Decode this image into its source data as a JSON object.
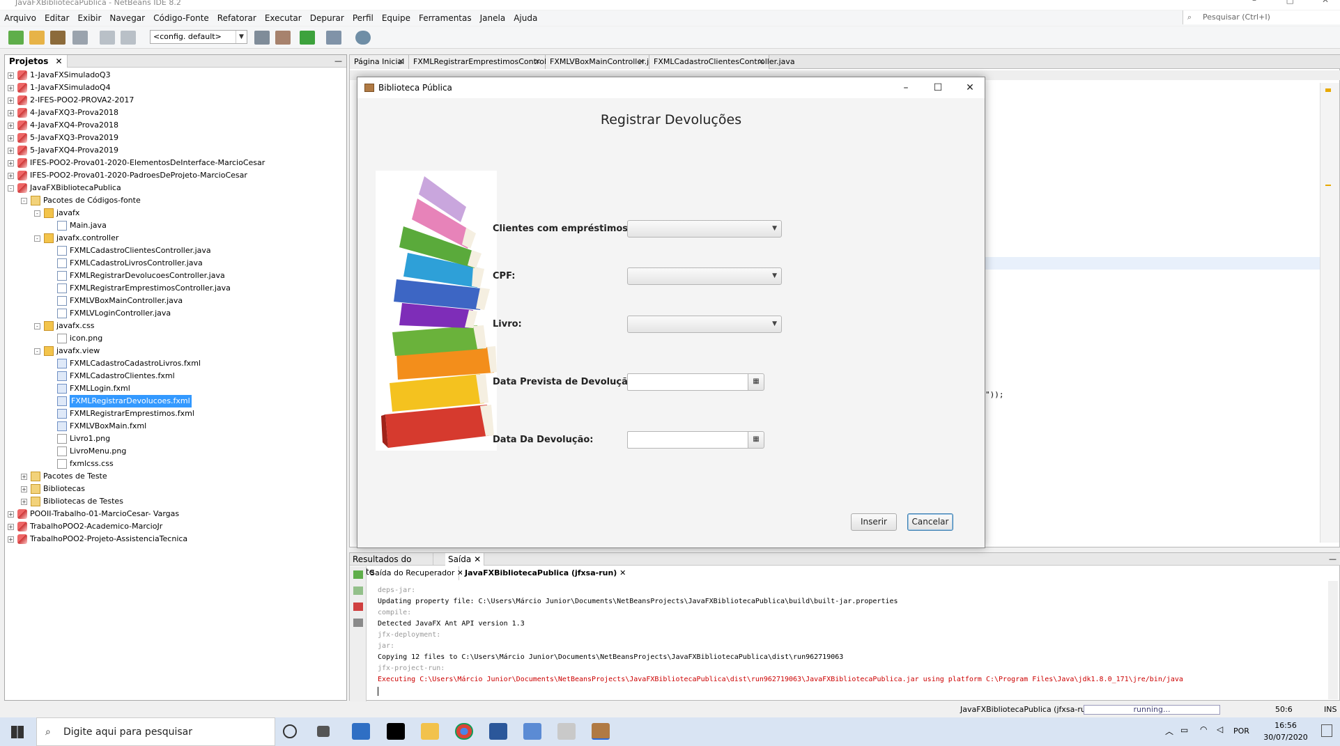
{
  "window": {
    "title": "JavaFXBibliotecaPublica - NetBeans IDE 8.2"
  },
  "menu": [
    "Arquivo",
    "Editar",
    "Exibir",
    "Navegar",
    "Código-Fonte",
    "Refatorar",
    "Executar",
    "Depurar",
    "Perfil",
    "Equipe",
    "Ferramentas",
    "Janela",
    "Ajuda"
  ],
  "search": {
    "placeholder": "Pesquisar (Ctrl+I)"
  },
  "toolbar": {
    "config": "<config. default>"
  },
  "projects": {
    "tab_label": "Projetos",
    "items": [
      {
        "label": "1-JavaFXSimuladoQ3",
        "level": 0,
        "icon": "project-icon",
        "toggle": "+"
      },
      {
        "label": "1-JavaFXSimuladoQ4",
        "level": 0,
        "icon": "project-icon",
        "toggle": "+"
      },
      {
        "label": "2-IFES-POO2-PROVA2-2017",
        "level": 0,
        "icon": "project-icon",
        "toggle": "+"
      },
      {
        "label": "4-JavaFXQ3-Prova2018",
        "level": 0,
        "icon": "project-icon",
        "toggle": "+"
      },
      {
        "label": "4-JavaFXQ4-Prova2018",
        "level": 0,
        "icon": "project-icon",
        "toggle": "+"
      },
      {
        "label": "5-JavaFXQ3-Prova2019",
        "level": 0,
        "icon": "project-icon",
        "toggle": "+"
      },
      {
        "label": "5-JavaFXQ4-Prova2019",
        "level": 0,
        "icon": "project-icon",
        "toggle": "+"
      },
      {
        "label": "IFES-POO2-Prova01-2020-ElementosDeInterface-MarcioCesar",
        "level": 0,
        "icon": "project-icon",
        "toggle": "+"
      },
      {
        "label": "IFES-POO2-Prova01-2020-PadroesDeProjeto-MarcioCesar",
        "level": 0,
        "icon": "project-icon",
        "toggle": "+"
      },
      {
        "label": "JavaFXBibliotecaPublica",
        "level": 0,
        "icon": "project-icon",
        "toggle": "-"
      },
      {
        "label": "Pacotes de Códigos-fonte",
        "level": 1,
        "icon": "folder-icon",
        "toggle": "-"
      },
      {
        "label": "javafx",
        "level": 2,
        "icon": "package-icon",
        "toggle": "-"
      },
      {
        "label": "Main.java",
        "level": 3,
        "icon": "java-file-icon",
        "toggle": ""
      },
      {
        "label": "javafx.controller",
        "level": 2,
        "icon": "package-icon",
        "toggle": "-"
      },
      {
        "label": "FXMLCadastroClientesController.java",
        "level": 3,
        "icon": "java-file-icon",
        "toggle": ""
      },
      {
        "label": "FXMLCadastroLivrosController.java",
        "level": 3,
        "icon": "java-file-icon",
        "toggle": ""
      },
      {
        "label": "FXMLRegistrarDevolucoesController.java",
        "level": 3,
        "icon": "java-file-icon",
        "toggle": ""
      },
      {
        "label": "FXMLRegistrarEmprestimosController.java",
        "level": 3,
        "icon": "java-file-icon",
        "toggle": ""
      },
      {
        "label": "FXMLVBoxMainController.java",
        "level": 3,
        "icon": "java-file-icon",
        "toggle": ""
      },
      {
        "label": "FXMLVLoginController.java",
        "level": 3,
        "icon": "java-file-icon",
        "toggle": ""
      },
      {
        "label": "javafx.css",
        "level": 2,
        "icon": "package-icon",
        "toggle": "-"
      },
      {
        "label": "icon.png",
        "level": 3,
        "icon": "image-file-icon",
        "toggle": ""
      },
      {
        "label": "javafx.view",
        "level": 2,
        "icon": "package-icon",
        "toggle": "-"
      },
      {
        "label": "FXMLCadastroCadastroLivros.fxml",
        "level": 3,
        "icon": "fxml-file-icon",
        "toggle": ""
      },
      {
        "label": "FXMLCadastroClientes.fxml",
        "level": 3,
        "icon": "fxml-file-icon",
        "toggle": ""
      },
      {
        "label": "FXMLLogin.fxml",
        "level": 3,
        "icon": "fxml-file-icon",
        "toggle": ""
      },
      {
        "label": "FXMLRegistrarDevolucoes.fxml",
        "level": 3,
        "icon": "fxml-file-icon",
        "toggle": "",
        "selected": true
      },
      {
        "label": "FXMLRegistrarEmprestimos.fxml",
        "level": 3,
        "icon": "fxml-file-icon",
        "toggle": ""
      },
      {
        "label": "FXMLVBoxMain.fxml",
        "level": 3,
        "icon": "fxml-file-icon",
        "toggle": ""
      },
      {
        "label": "Livro1.png",
        "level": 3,
        "icon": "image-file-icon",
        "toggle": ""
      },
      {
        "label": "LivroMenu.png",
        "level": 3,
        "icon": "image-file-icon",
        "toggle": ""
      },
      {
        "label": "fxmlcss.css",
        "level": 3,
        "icon": "image-file-icon",
        "toggle": ""
      },
      {
        "label": "Pacotes de Teste",
        "level": 1,
        "icon": "folder-icon",
        "toggle": "+"
      },
      {
        "label": "Bibliotecas",
        "level": 1,
        "icon": "folder-icon",
        "toggle": "+"
      },
      {
        "label": "Bibliotecas de Testes",
        "level": 1,
        "icon": "folder-icon",
        "toggle": "+"
      },
      {
        "label": "POOII-Trabalho-01-MarcioCesar- Vargas",
        "level": 0,
        "icon": "project-icon",
        "toggle": "+"
      },
      {
        "label": "TrabalhoPOO2-Academico-MarcioJr",
        "level": 0,
        "icon": "project-icon",
        "toggle": "+"
      },
      {
        "label": "TrabalhoPOO2-Projeto-AssistenciaTecnica",
        "level": 0,
        "icon": "project-icon",
        "toggle": "+"
      }
    ]
  },
  "editor": {
    "tabs": [
      "Página Inicial",
      "FXMLRegistrarEmprestimosController.java",
      "FXMLVBoxMainController.java",
      "FXMLCadastroClientesController.java"
    ],
    "code_fragment": "\"));"
  },
  "dialog": {
    "title": "Biblioteca Pública",
    "heading": "Registrar Devoluções",
    "labels": {
      "clientes": "Clientes com empréstimos:",
      "cpf": "CPF:",
      "livro": "Livro:",
      "data_prevista": "Data Prevista de Devolução",
      "data_devolucao": "Data Da Devolução:"
    },
    "buttons": {
      "inserir": "Inserir",
      "cancelar": "Cancelar"
    }
  },
  "output": {
    "tabs": [
      "Resultados do Teste",
      "Saída"
    ],
    "subtabs": [
      "Saída do Recuperador",
      "JavaFXBibliotecaPublica (jfxsa-run)"
    ],
    "lines": [
      {
        "text": "deps-jar:",
        "style": "g"
      },
      {
        "text": "Updating property file: C:\\Users\\Márcio Junior\\Documents\\NetBeansProjects\\JavaFXBibliotecaPublica\\build\\built-jar.properties",
        "style": ""
      },
      {
        "text": "compile:",
        "style": "g"
      },
      {
        "text": "Detected JavaFX Ant API version 1.3",
        "style": ""
      },
      {
        "text": "jfx-deployment:",
        "style": "g"
      },
      {
        "text": "jar:",
        "style": "g"
      },
      {
        "text": "Copying 12 files to C:\\Users\\Márcio Junior\\Documents\\NetBeansProjects\\JavaFXBibliotecaPublica\\dist\\run962719063",
        "style": ""
      },
      {
        "text": "jfx-project-run:",
        "style": "g"
      },
      {
        "text": "Executing C:\\Users\\Márcio Junior\\Documents\\NetBeansProjects\\JavaFXBibliotecaPublica\\dist\\run962719063\\JavaFXBibliotecaPublica.jar using platform C:\\Program Files\\Java\\jdk1.8.0_171\\jre/bin/java",
        "style": "r"
      }
    ]
  },
  "status": {
    "project": "JavaFXBibliotecaPublica (jfxsa-run)",
    "progress": "running...",
    "position": "50:6",
    "mode": "INS"
  },
  "taskbar": {
    "search_placeholder": "Digite aqui para pesquisar",
    "lang": "POR",
    "time": "16:56",
    "date": "30/07/2020"
  }
}
